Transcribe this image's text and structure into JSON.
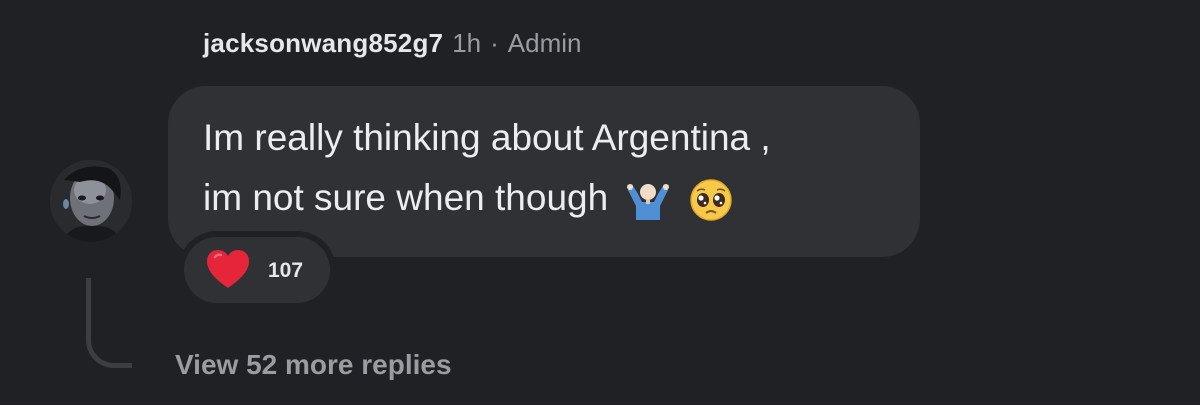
{
  "comment": {
    "username": "jacksonwang852g7",
    "time": "1h",
    "separator": "·",
    "role": "Admin",
    "text_line1": "Im really thinking about Argentina ,",
    "text_line2": "im not sure when though",
    "emojis": [
      "shrug-emoji",
      "pleading-face-emoji"
    ]
  },
  "reaction": {
    "icon": "heart-icon",
    "count": "107",
    "color": "#e4253a"
  },
  "replies": {
    "label": "View 52 more replies"
  },
  "colors": {
    "background": "#202124",
    "bubble": "#2f3134",
    "muted_text": "#9a9ca2"
  }
}
